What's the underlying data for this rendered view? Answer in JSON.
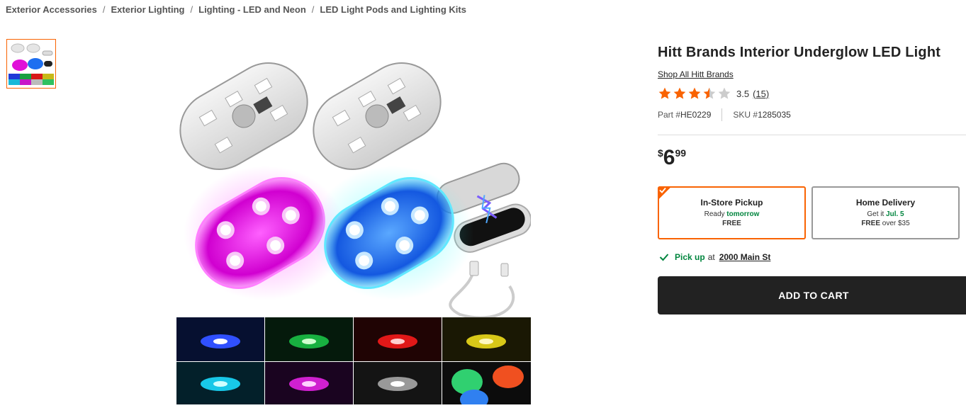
{
  "breadcrumb": {
    "items": [
      "Exterior Accessories",
      "Exterior Lighting",
      "Lighting - LED and Neon",
      "LED Light Pods and Lighting Kits"
    ],
    "separator": "/"
  },
  "product": {
    "title": "Hitt Brands Interior Underglow LED Light",
    "brand_link": "Shop All Hitt Brands",
    "rating": 3.5,
    "rating_text": "3.5",
    "review_count": "(15)",
    "part_label": "Part #",
    "part_number": "HE0229",
    "sku_label": "SKU #",
    "sku_number": "1285035",
    "price": {
      "currency": "$",
      "dollars": "6",
      "cents": "99"
    }
  },
  "fulfillment": {
    "pickup": {
      "title": "In-Store Pickup",
      "status_prefix": "Ready",
      "status_highlight": "tomorrow",
      "price": "FREE"
    },
    "delivery": {
      "title": "Home Delivery",
      "status_prefix": "Get it",
      "status_highlight": "Jul. 5",
      "price_bold": "FREE",
      "price_rest": "over $35"
    }
  },
  "store": {
    "pickup_label": "Pick up",
    "at_label": "at",
    "store_name": "2000 Main St"
  },
  "cart": {
    "button_label": "ADD TO CART"
  },
  "colors": {
    "accent": "#f96302",
    "green": "#00853e",
    "button_bg": "#222222"
  },
  "icons": {
    "star": "star-icon",
    "check": "check-icon"
  }
}
